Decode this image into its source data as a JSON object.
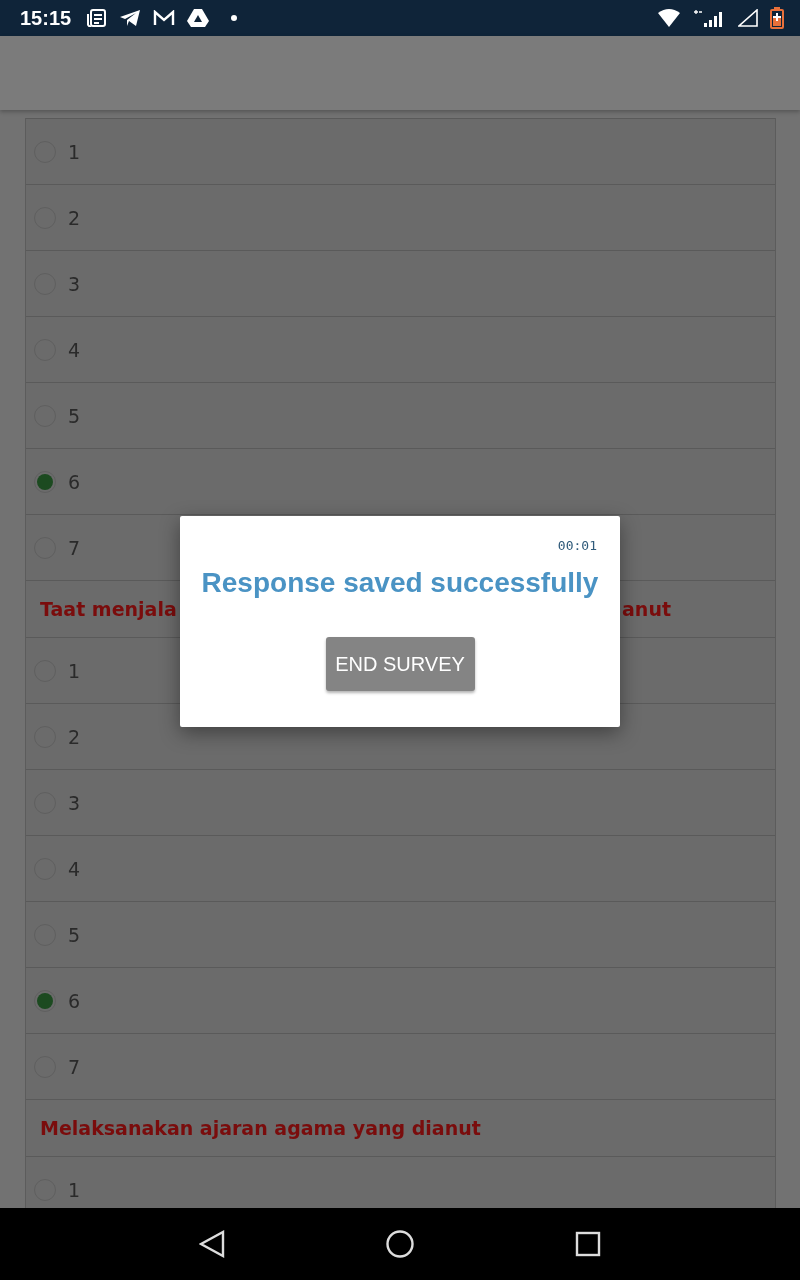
{
  "status_bar": {
    "time": "15:15"
  },
  "questions": [
    {
      "options": [
        {
          "label": "1",
          "selected": false
        },
        {
          "label": "2",
          "selected": false
        },
        {
          "label": "3",
          "selected": false
        },
        {
          "label": "4",
          "selected": false
        },
        {
          "label": "5",
          "selected": false
        },
        {
          "label": "6",
          "selected": true
        },
        {
          "label": "7",
          "selected": false
        }
      ]
    },
    {
      "title_parts": [
        "Taat menjala",
        "anut"
      ],
      "options": [
        {
          "label": "1",
          "selected": false
        },
        {
          "label": "2",
          "selected": false
        },
        {
          "label": "3",
          "selected": false
        },
        {
          "label": "4",
          "selected": false
        },
        {
          "label": "5",
          "selected": false
        },
        {
          "label": "6",
          "selected": true
        },
        {
          "label": "7",
          "selected": false
        }
      ]
    },
    {
      "title_parts": [
        "Melaksanakan ajaran agama yang dianut"
      ],
      "options": [
        {
          "label": "1",
          "selected": false
        }
      ]
    }
  ],
  "dialog": {
    "timer": "00:01",
    "message": "Response saved successfully",
    "button": "END SURVEY"
  }
}
